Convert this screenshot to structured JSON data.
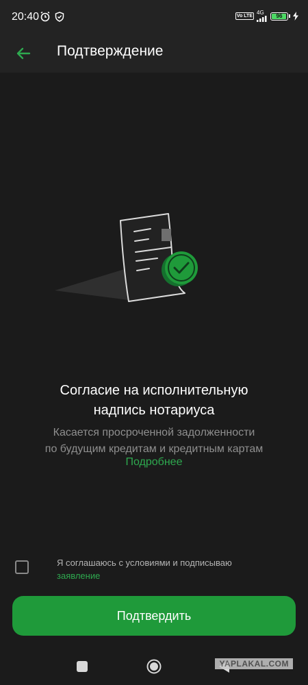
{
  "status_bar": {
    "time": "20:40",
    "volte": "Vo LTE",
    "network": "4G",
    "battery_percent": 96
  },
  "header": {
    "title": "Подтверждение"
  },
  "content": {
    "title_line1": "Согласие на исполнительную",
    "title_line2": "надпись нотариуса",
    "subtitle_line1": "Касается просроченной задолженности",
    "subtitle_line2": "по будущим кредитам и кредитным картам",
    "more_link": "Подробнее"
  },
  "consent": {
    "checked": false,
    "text": "Я соглашаюсь с условиями и подписываю",
    "link": "заявление"
  },
  "confirm_button": {
    "label": "Подтвердить"
  },
  "watermark": "YAPLAKAL.COM",
  "colors": {
    "accent": "#1f9a3a",
    "link": "#2ea94f",
    "background": "#1b1b1b",
    "header": "#232323"
  }
}
